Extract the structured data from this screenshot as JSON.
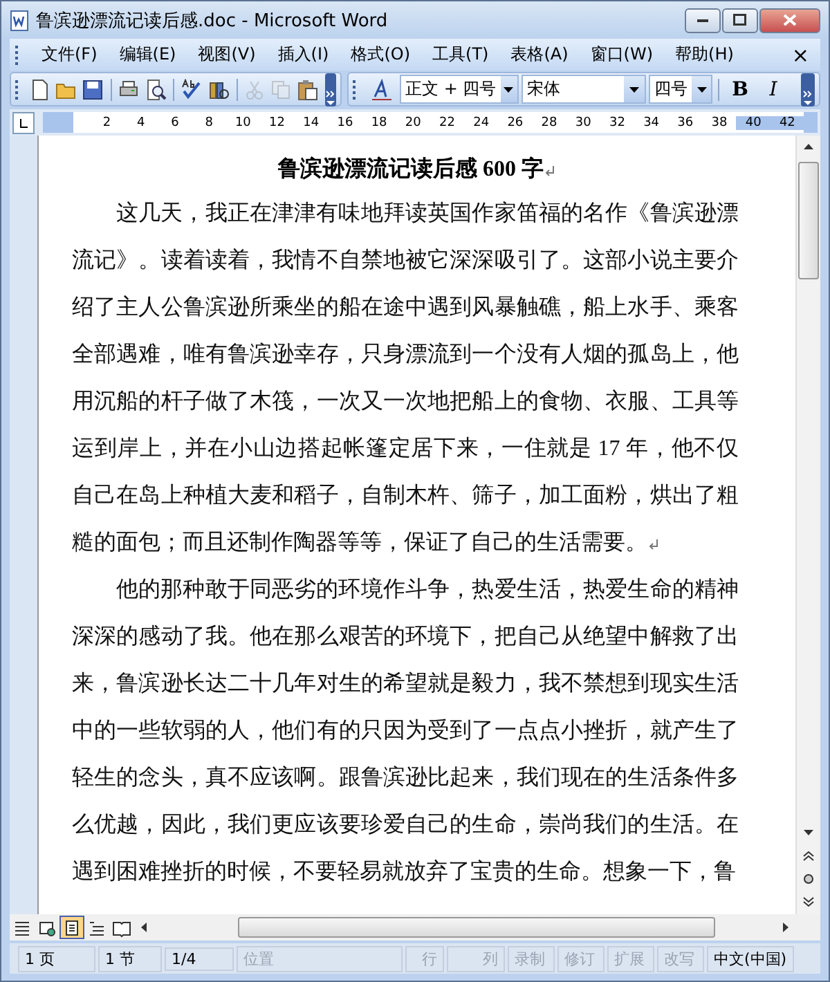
{
  "window": {
    "title": "鲁滨逊漂流记读后感.doc - Microsoft Word"
  },
  "menu": {
    "items": [
      "文件(F)",
      "编辑(E)",
      "视图(V)",
      "插入(I)",
      "格式(O)",
      "工具(T)",
      "表格(A)",
      "窗口(W)",
      "帮助(H)"
    ],
    "close": "×"
  },
  "toolbar": {
    "icons": [
      {
        "kind": "new"
      },
      {
        "kind": "open"
      },
      {
        "kind": "save"
      },
      {
        "kind": "sep"
      },
      {
        "kind": "print"
      },
      {
        "kind": "preview"
      },
      {
        "kind": "sep"
      },
      {
        "kind": "spell"
      },
      {
        "kind": "research"
      },
      {
        "kind": "sep"
      },
      {
        "kind": "cut",
        "disabled": true
      },
      {
        "kind": "copy",
        "disabled": true
      },
      {
        "kind": "paste",
        "disabled": false
      }
    ],
    "style": "正文 + 四号",
    "font": "宋体",
    "size": "四号",
    "bold": "B",
    "italic": "I"
  },
  "ruler": {
    "numbers": [
      "2",
      "4",
      "6",
      "8",
      "10",
      "12",
      "14",
      "16",
      "18",
      "20",
      "22",
      "24",
      "26",
      "28",
      "30",
      "32",
      "34",
      "36",
      "38",
      "40",
      "42"
    ]
  },
  "document": {
    "title": "鲁滨逊漂流记读后感 600 字",
    "paragraphs": [
      {
        "text": "这几天，我正在津津有味地拜读英国作家笛福的名作《鲁滨逊漂流记》。读着读着，我情不自禁地被它深深吸引了。这部小说主要介绍了主人公鲁滨逊所乘坐的船在途中遇到风暴触礁，船上水手、乘客全部遇难，唯有鲁滨逊幸存，只身漂流到一个没有人烟的孤岛上，他用沉船的杆子做了木筏，一次又一次地把船上的食物、衣服、工具等运到岸上，并在小山边搭起帐篷定居下来，一住就是 17 年，他不仅自己在岛上种植大麦和稻子，自制木杵、筛子，加工面粉，烘出了粗糙的面包；而且还制作陶器等等，保证了自己的生活需要。",
        "mark": true
      },
      {
        "text": "他的那种敢于同恶劣的环境作斗争，热爱生活，热爱生命的精神深深的感动了我。他在那么艰苦的环境下，把自己从绝望中解救了出来，鲁滨逊长达二十几年对生的希望就是毅力，我不禁想到现实生活中的一些软弱的人，他们有的只因为受到了一点点小挫折，就产生了轻生的念头，真不应该啊。跟鲁滨逊比起来，我们现在的生活条件多么优越，因此，我们更应该要珍爱自己的生命，崇尚我们的生活。在遇到困难挫折的时候，不要轻易就放弃了宝贵的生命。想象一下，鲁",
        "mark": false
      }
    ]
  },
  "views": [
    {
      "kind": "normal",
      "selected": false
    },
    {
      "kind": "web",
      "selected": false
    },
    {
      "kind": "print",
      "selected": true
    },
    {
      "kind": "outline",
      "selected": false
    },
    {
      "kind": "reading",
      "selected": false
    }
  ],
  "status_bar": [
    {
      "text": "1 页",
      "disabled": false
    },
    {
      "text": "1 节",
      "disabled": false
    },
    {
      "text": "1/4",
      "disabled": false
    },
    {
      "text": "位置",
      "disabled": true
    },
    {
      "text": "行",
      "disabled": true
    },
    {
      "text": "列",
      "disabled": true
    },
    {
      "text": "录制",
      "disabled": true
    },
    {
      "text": "修订",
      "disabled": true
    },
    {
      "text": "扩展",
      "disabled": true
    },
    {
      "text": "改写",
      "disabled": true
    },
    {
      "text": "中文(中国)",
      "disabled": false
    }
  ]
}
